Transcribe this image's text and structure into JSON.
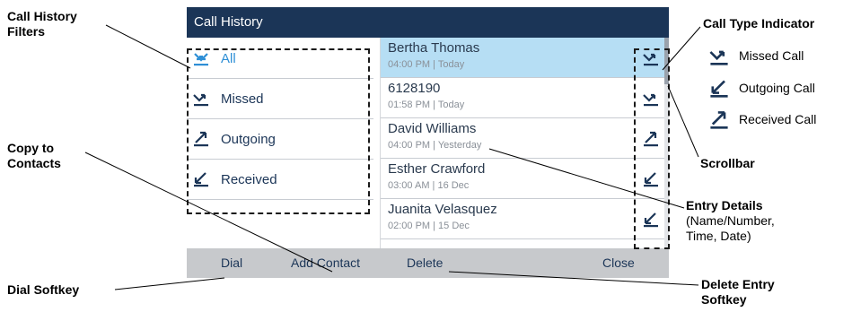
{
  "screen": {
    "title": "Call History",
    "filters": [
      {
        "label": "All",
        "icon": "all-calls-icon",
        "selected": true
      },
      {
        "label": "Missed",
        "icon": "missed-call-icon",
        "selected": false
      },
      {
        "label": "Outgoing",
        "icon": "outgoing-call-icon",
        "selected": false
      },
      {
        "label": "Received",
        "icon": "received-call-icon",
        "selected": false
      }
    ],
    "entries": [
      {
        "name": "Bertha Thomas",
        "detail": "04:00 PM | Today",
        "type_icon": "missed-call-icon",
        "selected": true
      },
      {
        "name": "6128190",
        "detail": "01:58 PM | Today",
        "type_icon": "missed-call-icon",
        "selected": false
      },
      {
        "name": "David Williams",
        "detail": "04:00 PM | Yesterday",
        "type_icon": "received-call-icon",
        "selected": false
      },
      {
        "name": "Esther Crawford",
        "detail": "03:00 AM | 16 Dec",
        "type_icon": "outgoing-call-icon",
        "selected": false
      },
      {
        "name": "Juanita Velasquez",
        "detail": "02:00 PM | 15 Dec",
        "type_icon": "outgoing-call-icon",
        "selected": false
      }
    ],
    "softkeys": {
      "dial": "Dial",
      "add_contact": "Add Contact",
      "delete": "Delete",
      "close": "Close"
    }
  },
  "callouts": {
    "call_history_filters": [
      "Call History",
      "Filters"
    ],
    "copy_to_contacts": [
      "Copy to",
      "Contacts"
    ],
    "dial_softkey": "Dial Softkey",
    "call_type_indicator": "Call Type Indicator",
    "scrollbar": "Scrollbar",
    "entry_details_title": "Entry Details",
    "entry_details_desc": [
      "(Name/Number,",
      "Time, Date)"
    ],
    "delete_entry_softkey": [
      "Delete Entry",
      "Softkey"
    ]
  },
  "legend": [
    {
      "label": "Missed Call",
      "icon": "missed-call-icon"
    },
    {
      "label": "Outgoing Call",
      "icon": "outgoing-call-icon"
    },
    {
      "label": "Received Call",
      "icon": "received-call-icon"
    }
  ],
  "colors": {
    "title_bar": "#1b3557",
    "selected_row": "#b6def4",
    "selected_text": "#2e8fd6",
    "softkey_bar": "#c7c9cc"
  }
}
